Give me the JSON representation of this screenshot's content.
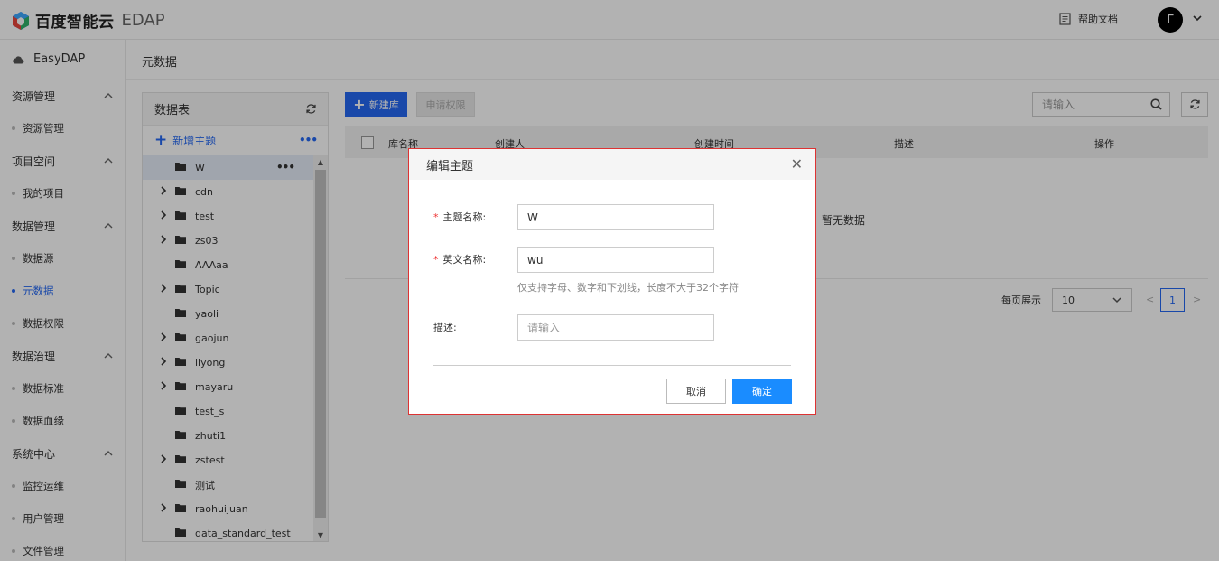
{
  "topbar": {
    "brand": "百度智能云",
    "product": "EDAP",
    "help_label": "帮助文档",
    "avatar_letter": "Γ"
  },
  "sidebar": {
    "app_name": "EasyDAP",
    "groups": [
      {
        "label": "资源管理",
        "items": [
          "资源管理"
        ]
      },
      {
        "label": "项目空间",
        "items": [
          "我的项目"
        ]
      },
      {
        "label": "数据管理",
        "items": [
          "数据源",
          "元数据",
          "数据权限"
        ]
      },
      {
        "label": "数据治理",
        "items": [
          "数据标准",
          "数据血缘"
        ]
      },
      {
        "label": "系统中心",
        "items": [
          "监控运维",
          "用户管理",
          "文件管理"
        ]
      }
    ],
    "active_item": "元数据"
  },
  "breadcrumb": "元数据",
  "tree": {
    "title": "数据表",
    "add_label": "新增主题",
    "nodes": [
      {
        "name": "W",
        "expandable": false,
        "selected": true
      },
      {
        "name": "cdn",
        "expandable": true
      },
      {
        "name": "test",
        "expandable": true
      },
      {
        "name": "zs03",
        "expandable": true
      },
      {
        "name": "AAAaa",
        "expandable": false
      },
      {
        "name": "Topic",
        "expandable": true
      },
      {
        "name": "yaoli",
        "expandable": false
      },
      {
        "name": "gaojun",
        "expandable": true
      },
      {
        "name": "liyong",
        "expandable": true
      },
      {
        "name": "mayaru",
        "expandable": true
      },
      {
        "name": "test_s",
        "expandable": false
      },
      {
        "name": "zhuti1",
        "expandable": false
      },
      {
        "name": "zstest",
        "expandable": true
      },
      {
        "name": "测试",
        "expandable": false
      },
      {
        "name": "raohuijuan",
        "expandable": true
      },
      {
        "name": "data_standard_test",
        "expandable": false
      }
    ]
  },
  "toolbar": {
    "new_db_label": "新建库",
    "apply_label": "申请权限",
    "search_placeholder": "请输入"
  },
  "table": {
    "columns": [
      "库名称",
      "创建人",
      "创建时间",
      "描述",
      "操作"
    ],
    "empty_text": "暂无数据"
  },
  "pager": {
    "page_size_label": "每页展示",
    "page_size": "10",
    "current_page": "1",
    "prev": "<",
    "next": ">"
  },
  "dialog": {
    "title": "编辑主题",
    "name_label": "主题名称:",
    "name_value": "W",
    "en_label": "英文名称:",
    "en_value": "wu",
    "en_hint": "仅支持字母、数字和下划线，长度不大于32个字符",
    "desc_label": "描述:",
    "desc_placeholder": "请输入",
    "cancel_label": "取消",
    "ok_label": "确定"
  },
  "colors": {
    "primary": "#2468f2",
    "ok_button": "#1a8cff",
    "dialog_border": "#dd3333",
    "required": "#ee3333"
  }
}
